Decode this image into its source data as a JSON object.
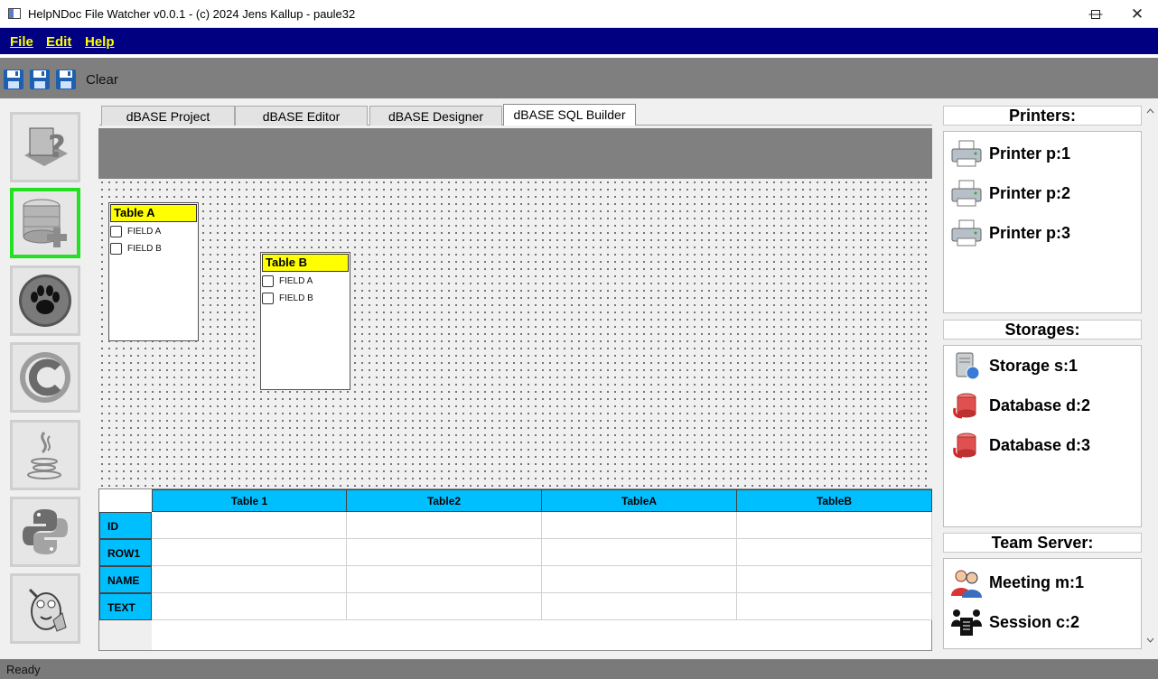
{
  "window": {
    "title": "HelpNDoc File Watcher v0.0.1 - (c) 2024 Jens Kallup - paule32"
  },
  "menu": [
    {
      "label": "File"
    },
    {
      "label": "Edit"
    },
    {
      "label": "Help"
    }
  ],
  "toolbar": {
    "clear_label": "Clear",
    "icons": [
      "floppy-disk-icon",
      "floppy-disk-icon",
      "floppy-disk-icon"
    ]
  },
  "sidebar": {
    "items": [
      {
        "icon": "help-book-icon",
        "active": false
      },
      {
        "icon": "database-add-icon",
        "active": true
      },
      {
        "icon": "paw-icon",
        "active": false
      },
      {
        "icon": "c-language-icon",
        "active": false
      },
      {
        "icon": "java-icon",
        "active": false
      },
      {
        "icon": "python-icon",
        "active": false
      },
      {
        "icon": "lisp-alien-icon",
        "active": false
      }
    ]
  },
  "tabs": [
    {
      "label": "dBASE Project",
      "selected": false
    },
    {
      "label": "dBASE Editor",
      "selected": false
    },
    {
      "label": "dBASE Designer",
      "selected": false
    },
    {
      "label": "dBASE SQL Builder",
      "selected": true
    }
  ],
  "designer": {
    "tables": [
      {
        "title": "Table A",
        "fields": [
          "FIELD A",
          "FIELD B"
        ]
      },
      {
        "title": "Table B",
        "fields": [
          "FIELD A",
          "FIELD B"
        ]
      }
    ]
  },
  "grid": {
    "columns": [
      "Table 1",
      "Table2",
      "TableA",
      "TableB"
    ],
    "rows": [
      "ID",
      "ROW1",
      "NAME",
      "TEXT"
    ]
  },
  "panels": {
    "printers": {
      "title": "Printers:",
      "items": [
        {
          "label": "Printer p:1"
        },
        {
          "label": "Printer p:2"
        },
        {
          "label": "Printer p:3"
        }
      ]
    },
    "storages": {
      "title": "Storages:",
      "items": [
        {
          "label": "Storage  s:1"
        },
        {
          "label": "Database d:2"
        },
        {
          "label": "Database d:3"
        }
      ]
    },
    "team": {
      "title": "Team Server:",
      "items": [
        {
          "label": "Meeting m:1"
        },
        {
          "label": "Session c:2"
        }
      ]
    }
  },
  "status": {
    "text": "Ready"
  },
  "colors": {
    "menubar": "#000080",
    "menu_text": "#ffff00",
    "grid_header": "#00bfff",
    "active_border": "#23e023",
    "table_header": "#ffff00"
  }
}
